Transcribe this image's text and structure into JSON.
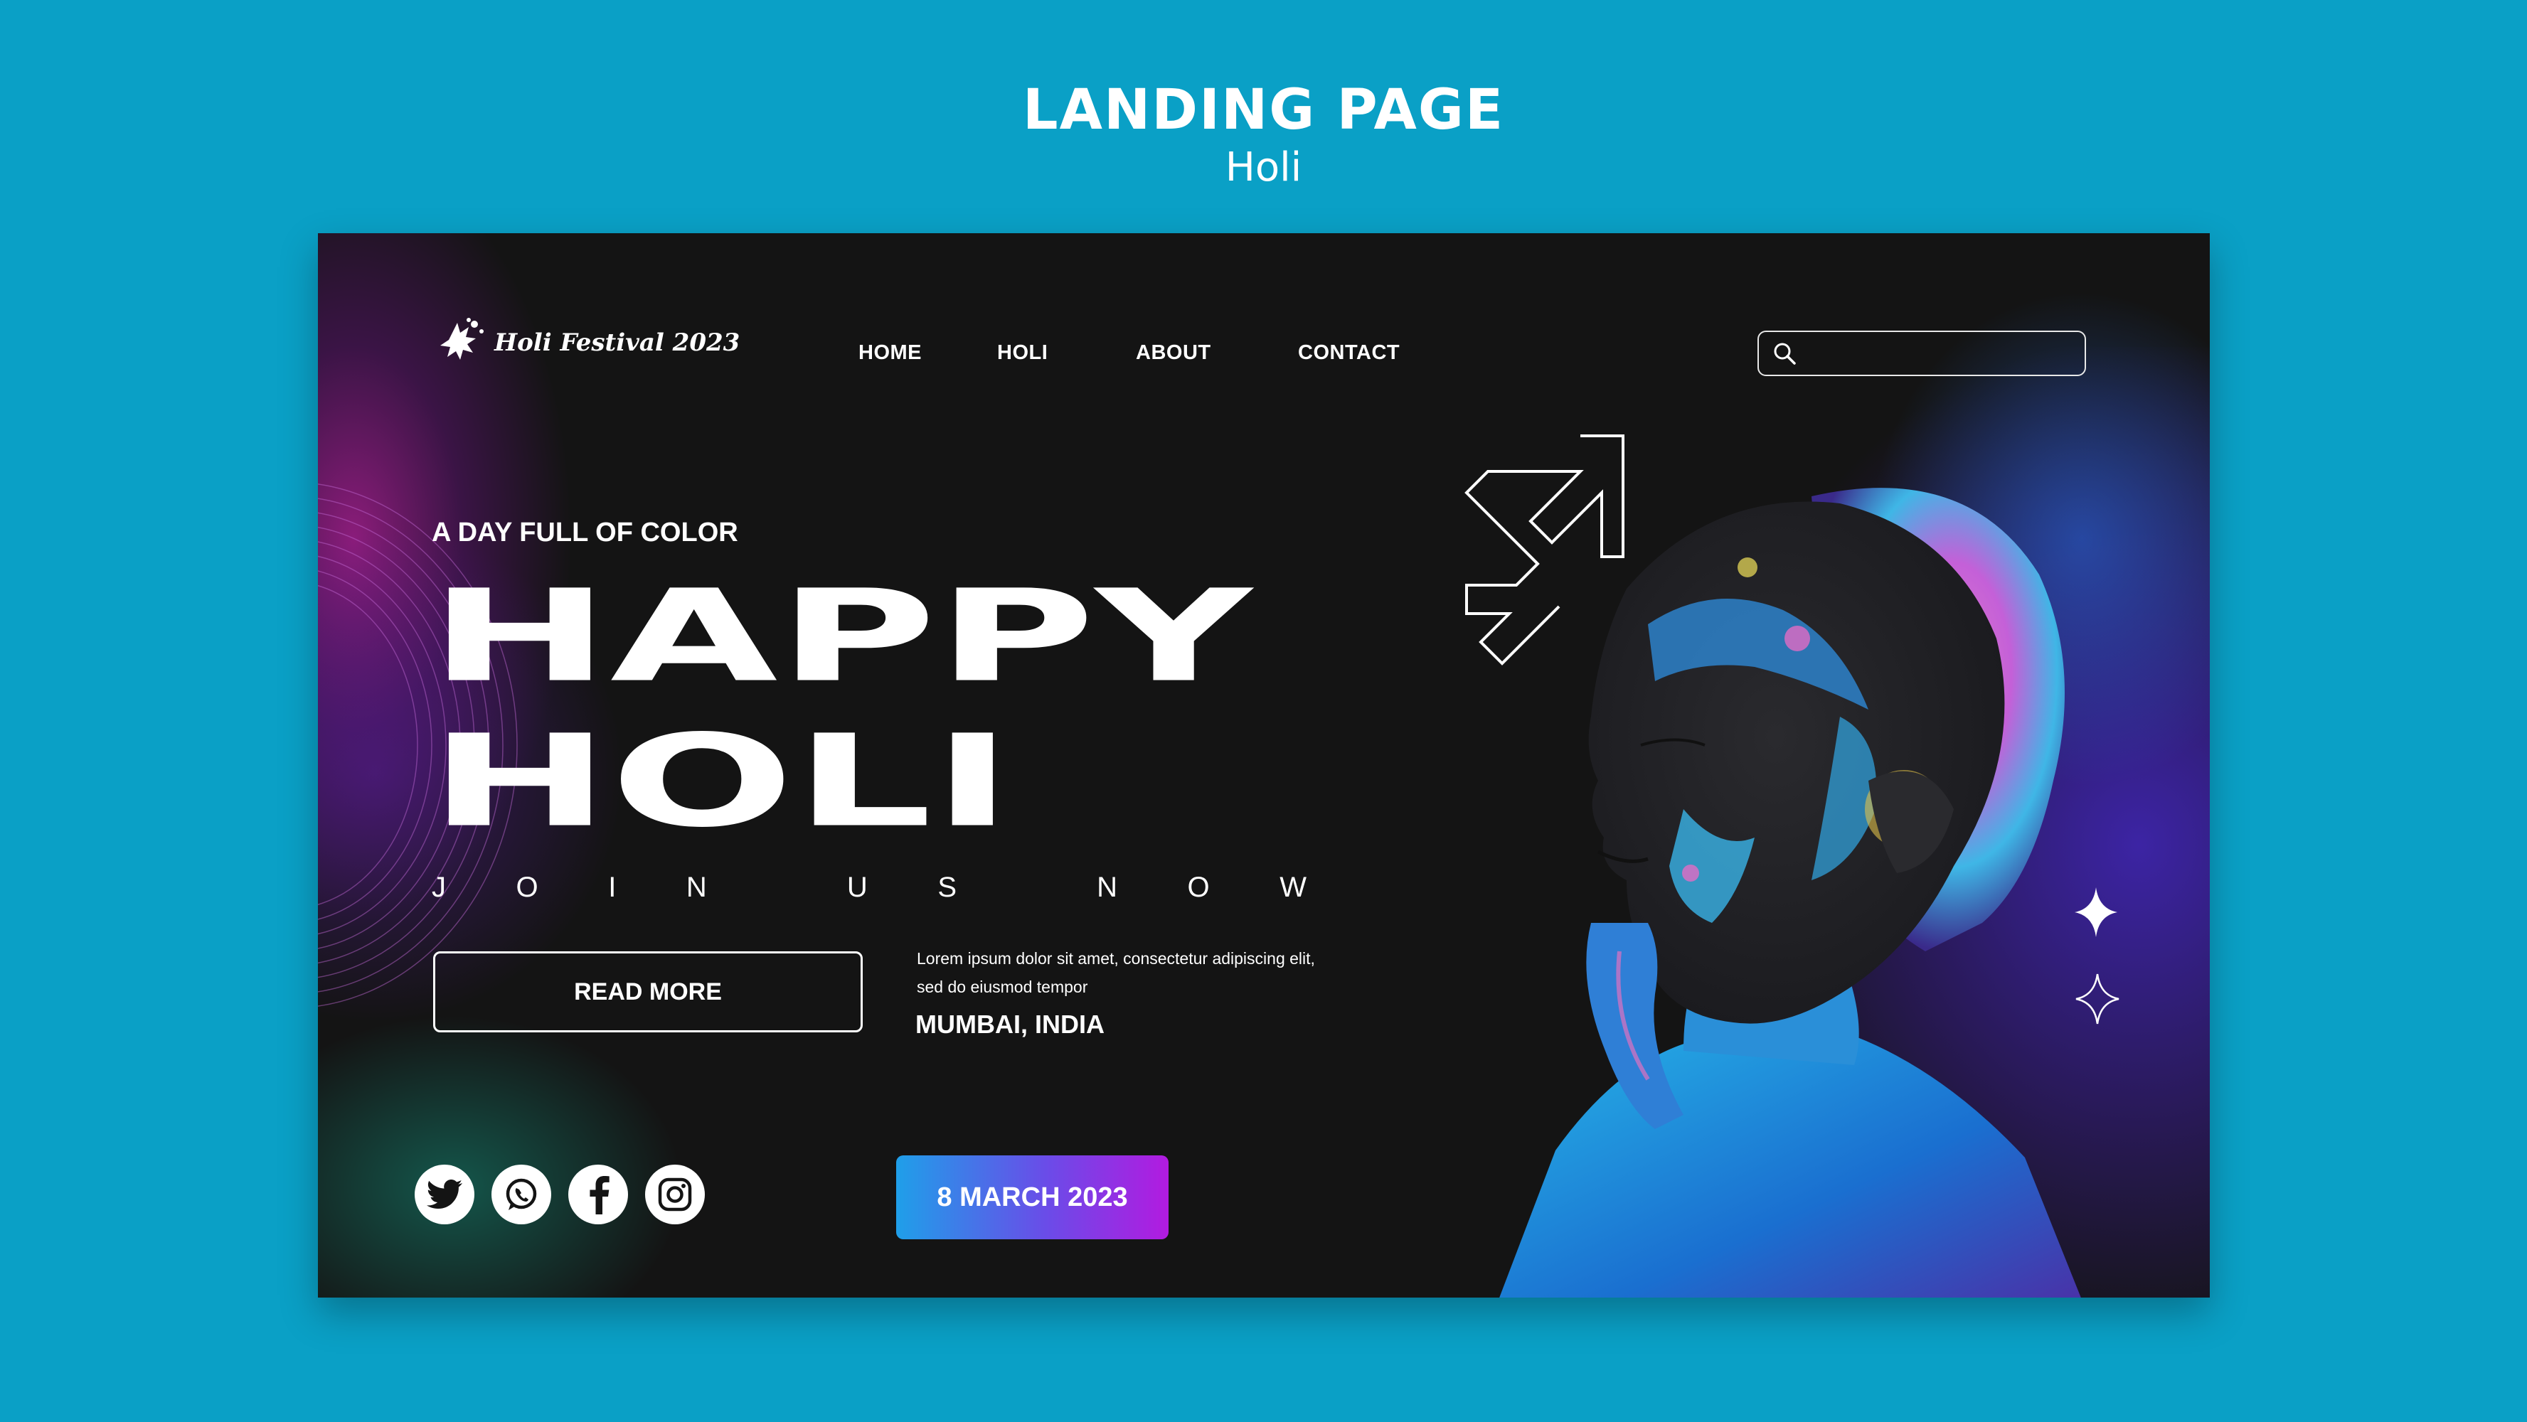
{
  "page": {
    "title": "LANDING PAGE",
    "subtitle": "Holi"
  },
  "logo": {
    "text": "Holi Festival 2023"
  },
  "nav": {
    "items": [
      {
        "label": "HOME"
      },
      {
        "label": "HOLI"
      },
      {
        "label": "ABOUT"
      },
      {
        "label": "CONTACT"
      }
    ]
  },
  "search": {
    "placeholder": ""
  },
  "hero": {
    "tagline": "A DAY FULL OF COLOR",
    "line1": "HAPPY",
    "line2": "HOLI",
    "join_letters": [
      "J",
      "O",
      "I",
      "N",
      "",
      "U",
      "S",
      "",
      "N",
      "O",
      "W"
    ]
  },
  "cta": {
    "read_more": "READ MORE",
    "description": "Lorem ipsum dolor sit amet, consectetur adipiscing elit, sed do eiusmod tempor",
    "location": "MUMBAI, INDIA",
    "date": "8 MARCH 2023"
  },
  "socials": [
    {
      "icon": "twitter-icon"
    },
    {
      "icon": "whatsapp-icon"
    },
    {
      "icon": "facebook-icon"
    },
    {
      "icon": "instagram-icon"
    }
  ],
  "colors": {
    "background": "#0aa0c6",
    "card": "#141414",
    "date_gradient_start": "#1f9fe9",
    "date_gradient_end": "#b21be0"
  }
}
